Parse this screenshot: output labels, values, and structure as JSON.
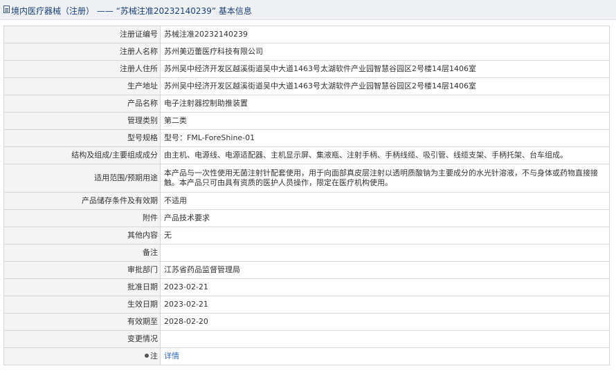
{
  "page_title": "境内医疗器械（注册） —— “苏械注准20232140239” 基本信息",
  "fields": [
    {
      "label": "注册证编号",
      "value": "苏械注准20232140239"
    },
    {
      "label": "注册人名称",
      "value": "苏州美迈蕾医疗科技有限公司"
    },
    {
      "label": "注册人住所",
      "value": "苏州吴中经济开发区越溪街道吴中大道1463号太湖软件产业园智慧谷园区2号楼14层1406室"
    },
    {
      "label": "生产地址",
      "value": "苏州吴中经济开发区越溪街道吴中大道1463号太湖软件产业园智慧谷园区2号楼14层1406室"
    },
    {
      "label": "产品名称",
      "value": "电子注射器控制助推装置"
    },
    {
      "label": "管理类别",
      "value": "第二类"
    },
    {
      "label": "型号规格",
      "value": "型号：FML-ForeShine-01"
    },
    {
      "label": "结构及组成/主要组成成分",
      "value": "由主机、电源线、电源适配器、主机显示屏、集液瓶、注射手柄、手柄线缆、吸引管、线缆支架、手柄托架、台车组成。"
    },
    {
      "label": "适用范围/预期用途",
      "value": "本产品与一次性使用无菌注射针配套使用，用于向面部真皮层注射以透明质酸钠为主要成分的水光针溶液，不与身体或药物直接接触。本产品只可由具有资质的医护人员操作，限定在医疗机构使用。"
    },
    {
      "label": "产品储存条件及有效期",
      "value": "不适用"
    },
    {
      "label": "附件",
      "value": "产品技术要求"
    },
    {
      "label": "其他内容",
      "value": "无"
    },
    {
      "label": "备注",
      "value": ""
    },
    {
      "label": "审批部门",
      "value": "江苏省药品监督管理局"
    },
    {
      "label": "批准日期",
      "value": "2023-02-21"
    },
    {
      "label": "生效日期",
      "value": "2023-02-21"
    },
    {
      "label": "有效期至",
      "value": "2028-02-20"
    },
    {
      "label": "变更情况",
      "value": ""
    }
  ],
  "note": {
    "label": "注",
    "link_text": "详情"
  }
}
